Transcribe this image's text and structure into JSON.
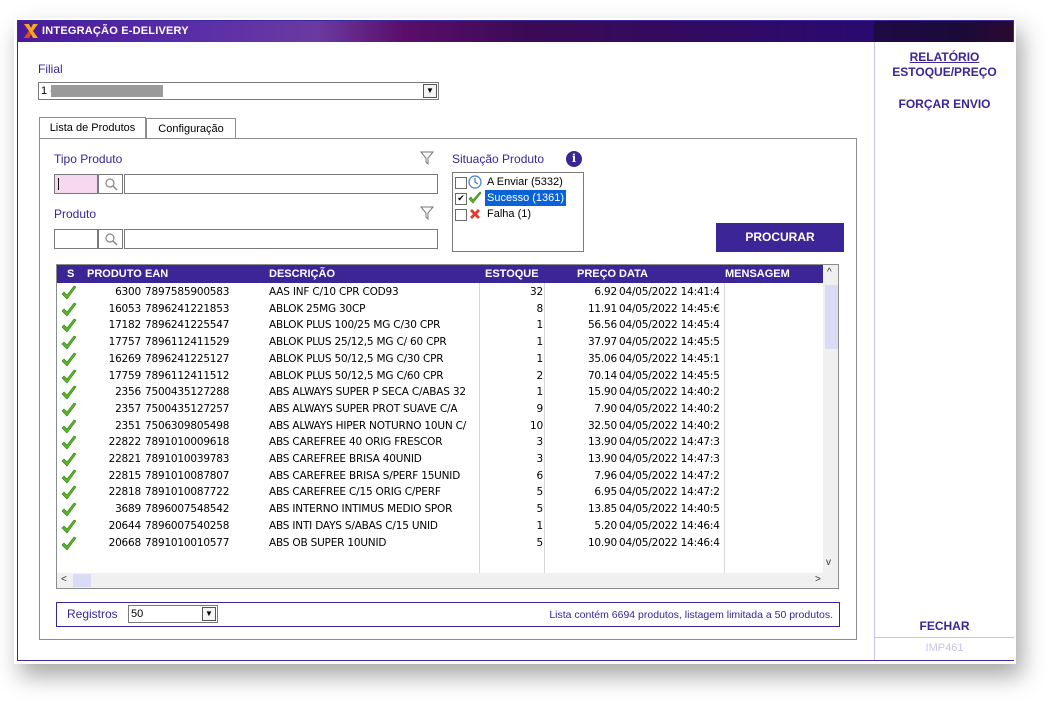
{
  "window": {
    "title": "INTEGRAÇÃO E-DELIVERY"
  },
  "side": {
    "relatorio_line1": "RELATÓRIO",
    "relatorio_line2": "ESTOQUE/PREÇO",
    "forcar": "FORÇAR ENVIO",
    "fechar": "FECHAR",
    "code": "IMP461"
  },
  "filial": {
    "label": "Filial",
    "value": "1 -"
  },
  "tabs": [
    {
      "label": "Lista de Produtos"
    },
    {
      "label": "Configuração"
    }
  ],
  "filters": {
    "tipo_label": "Tipo Produto",
    "produto_label": "Produto",
    "situacao_label": "Situação Produto",
    "situacao_items": [
      {
        "label": "A Enviar (5332)",
        "checked": false,
        "icon": "clock-icon"
      },
      {
        "label": "Sucesso (1361)",
        "checked": true,
        "icon": "check-icon",
        "selected": true
      },
      {
        "label": "Falha (1)",
        "checked": false,
        "icon": "x-icon"
      }
    ],
    "procurar": "PROCURAR"
  },
  "grid": {
    "headers": {
      "s": "S",
      "produto": "PRODUTO",
      "ean": "EAN",
      "descricao": "DESCRIÇÃO",
      "estoque": "ESTOQUE",
      "preco": "PREÇO",
      "data": "DATA",
      "mensagem": "MENSAGEM"
    },
    "rows": [
      {
        "produto": "6300",
        "ean": "7897585900583",
        "descricao": "AAS INF C/10 CPR COD93",
        "estoque": "32",
        "preco": "6.92",
        "data": "04/05/2022 14:41:4"
      },
      {
        "produto": "16053",
        "ean": "7896241221853",
        "descricao": "ABLOK 25MG 30CP",
        "estoque": "8",
        "preco": "11.91",
        "data": "04/05/2022 14:45:€"
      },
      {
        "produto": "17182",
        "ean": "7896241225547",
        "descricao": "ABLOK PLUS 100/25 MG C/30 CPR",
        "estoque": "1",
        "preco": "56.56",
        "data": "04/05/2022 14:45:4"
      },
      {
        "produto": "17757",
        "ean": "7896112411529",
        "descricao": "ABLOK PLUS 25/12,5 MG C/ 60 CPR",
        "estoque": "1",
        "preco": "37.97",
        "data": "04/05/2022 14:45:5"
      },
      {
        "produto": "16269",
        "ean": "7896241225127",
        "descricao": "ABLOK PLUS 50/12,5 MG C/30 CPR",
        "estoque": "1",
        "preco": "35.06",
        "data": "04/05/2022 14:45:1"
      },
      {
        "produto": "17759",
        "ean": "7896112411512",
        "descricao": "ABLOK PLUS 50/12,5 MG C/60 CPR",
        "estoque": "2",
        "preco": "70.14",
        "data": "04/05/2022 14:45:5"
      },
      {
        "produto": "2356",
        "ean": "7500435127288",
        "descricao": "ABS ALWAYS SUPER P SECA C/ABAS 32",
        "estoque": "1",
        "preco": "15.90",
        "data": "04/05/2022 14:40:2"
      },
      {
        "produto": "2357",
        "ean": "7500435127257",
        "descricao": "ABS ALWAYS  SUPER PROT SUAVE  C/A",
        "estoque": "9",
        "preco": "7.90",
        "data": "04/05/2022 14:40:2"
      },
      {
        "produto": "2351",
        "ean": "7506309805498",
        "descricao": "ABS ALWAYS HIPER  NOTURNO 10UN C/",
        "estoque": "10",
        "preco": "32.50",
        "data": "04/05/2022 14:40:2"
      },
      {
        "produto": "22822",
        "ean": "7891010009618",
        "descricao": "ABS CAREFREE 40 ORIG FRESCOR",
        "estoque": "3",
        "preco": "13.90",
        "data": "04/05/2022 14:47:3"
      },
      {
        "produto": "22821",
        "ean": "7891010039783",
        "descricao": "ABS CAREFREE BRISA 40UNID",
        "estoque": "3",
        "preco": "13.90",
        "data": "04/05/2022 14:47:3"
      },
      {
        "produto": "22815",
        "ean": "7891010087807",
        "descricao": "ABS CAREFREE BRISA S/PERF 15UNID",
        "estoque": "6",
        "preco": "7.96",
        "data": "04/05/2022 14:47:2"
      },
      {
        "produto": "22818",
        "ean": "7891010087722",
        "descricao": "ABS CAREFREE C/15 ORIG C/PERF",
        "estoque": "5",
        "preco": "6.95",
        "data": "04/05/2022 14:47:2"
      },
      {
        "produto": "3689",
        "ean": "7896007548542",
        "descricao": "ABS INTERNO INTIMUS  MEDIO SPOR",
        "estoque": "5",
        "preco": "13.85",
        "data": "04/05/2022 14:40:5"
      },
      {
        "produto": "20644",
        "ean": "7896007540258",
        "descricao": "ABS INTI DAYS S/ABAS C/15 UNID",
        "estoque": "1",
        "preco": "5.20",
        "data": "04/05/2022 14:46:4"
      },
      {
        "produto": "20668",
        "ean": "7891010010577",
        "descricao": "ABS OB SUPER 10UNID",
        "estoque": "5",
        "preco": "10.90",
        "data": "04/05/2022 14:46:4"
      }
    ]
  },
  "footer": {
    "registros_label": "Registros",
    "registros_value": "50",
    "info": "Lista contém 6694 produtos, listagem limitada a 50 produtos."
  },
  "colors": {
    "accent": "#3b2597",
    "selection": "#0a62d8",
    "check": "#5ab52a"
  }
}
